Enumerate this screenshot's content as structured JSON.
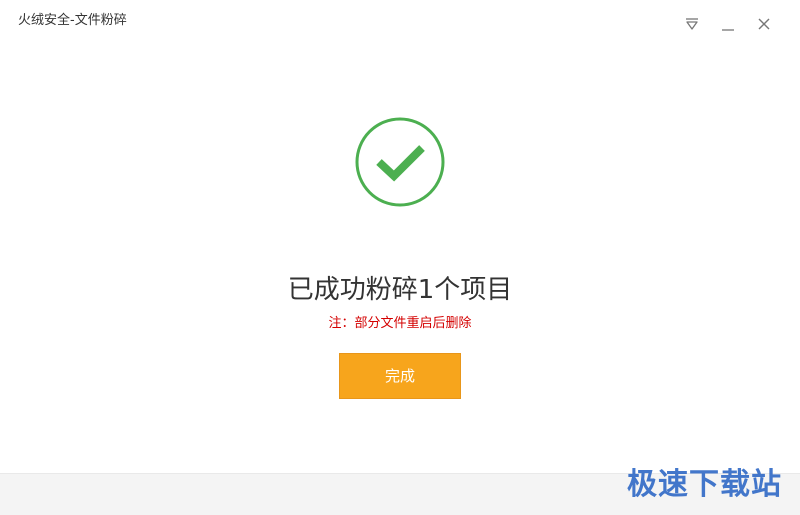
{
  "window": {
    "title": "火绒安全-文件粉碎",
    "controls": {
      "menu_icon": "menu-triangle-icon",
      "minimize_icon": "minimize-icon",
      "close_icon": "close-icon"
    }
  },
  "result": {
    "icon": "checkmark-circle-icon",
    "message": "已成功粉碎1个项目",
    "note": "注：部分文件重启后删除",
    "done_label": "完成"
  },
  "watermark": {
    "text": "极速下载站"
  },
  "colors": {
    "accent_green": "#4caf50",
    "button_orange": "#f7a51c",
    "note_red": "#d40000",
    "watermark_blue": "#2f69c6"
  }
}
